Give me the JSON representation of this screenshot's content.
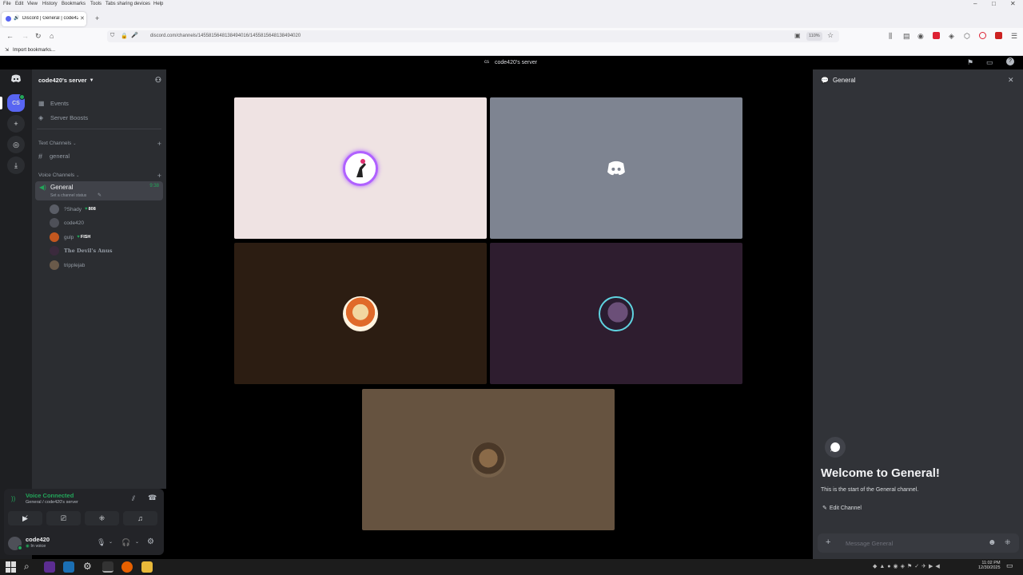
{
  "browser": {
    "menu": [
      "File",
      "Edit",
      "View",
      "History",
      "Bookmarks",
      "Tools",
      "Tabs sharing devices",
      "Help"
    ],
    "tab_title": "Discord | General | code420's",
    "url": "discord.com/channels/1455815648138494016/1455815648138494020",
    "zoom": "110%",
    "bookmark": "Import bookmarks..."
  },
  "discord": {
    "window_title": "code420's server",
    "guild_badge": "CS",
    "server_name": "code420's server",
    "nav": [
      "Events",
      "Server Boosts"
    ],
    "text_category": "Text Channels",
    "text_channel": "general",
    "voice_category": "Voice Channels",
    "voice_channel": "General",
    "voice_timer": "9:38",
    "channel_status": "Set a channel status",
    "members": [
      {
        "name": "?Shady",
        "badge": "808",
        "avatar_color": "#5a5d66"
      },
      {
        "name": "code420",
        "badge": "",
        "avatar_color": "#4e5058"
      },
      {
        "name": "gulp",
        "badge": "FISH",
        "avatar_color": "#c2571f"
      },
      {
        "name": "The Devil's Anus",
        "badge": "",
        "avatar_color": "#3b2a3d"
      },
      {
        "name": "tripplejab",
        "badge": "",
        "avatar_color": "#6a5a4a"
      }
    ],
    "voice_status": "Voice Connected",
    "voice_location": "General / code420's server",
    "user_name": "code420",
    "user_status": "In voice",
    "tiles": [
      {
        "name": "tile-user-1",
        "bg": "#efe3e3"
      },
      {
        "name": "tile-user-2",
        "bg": "#7e8491"
      },
      {
        "name": "tile-user-3",
        "bg": "#2c1d12"
      },
      {
        "name": "tile-user-4",
        "bg": "#2e1d2f"
      },
      {
        "name": "tile-user-5",
        "bg": "#665340"
      }
    ],
    "chat": {
      "title": "General",
      "welcome": "Welcome to General!",
      "subtitle": "This is the start of the General channel.",
      "edit": "Edit Channel",
      "placeholder": "Message General"
    },
    "accent": "#5865f2",
    "online": "#23a55a"
  },
  "taskbar": {
    "time": "11:02 PM",
    "date": "12/30/2025"
  }
}
